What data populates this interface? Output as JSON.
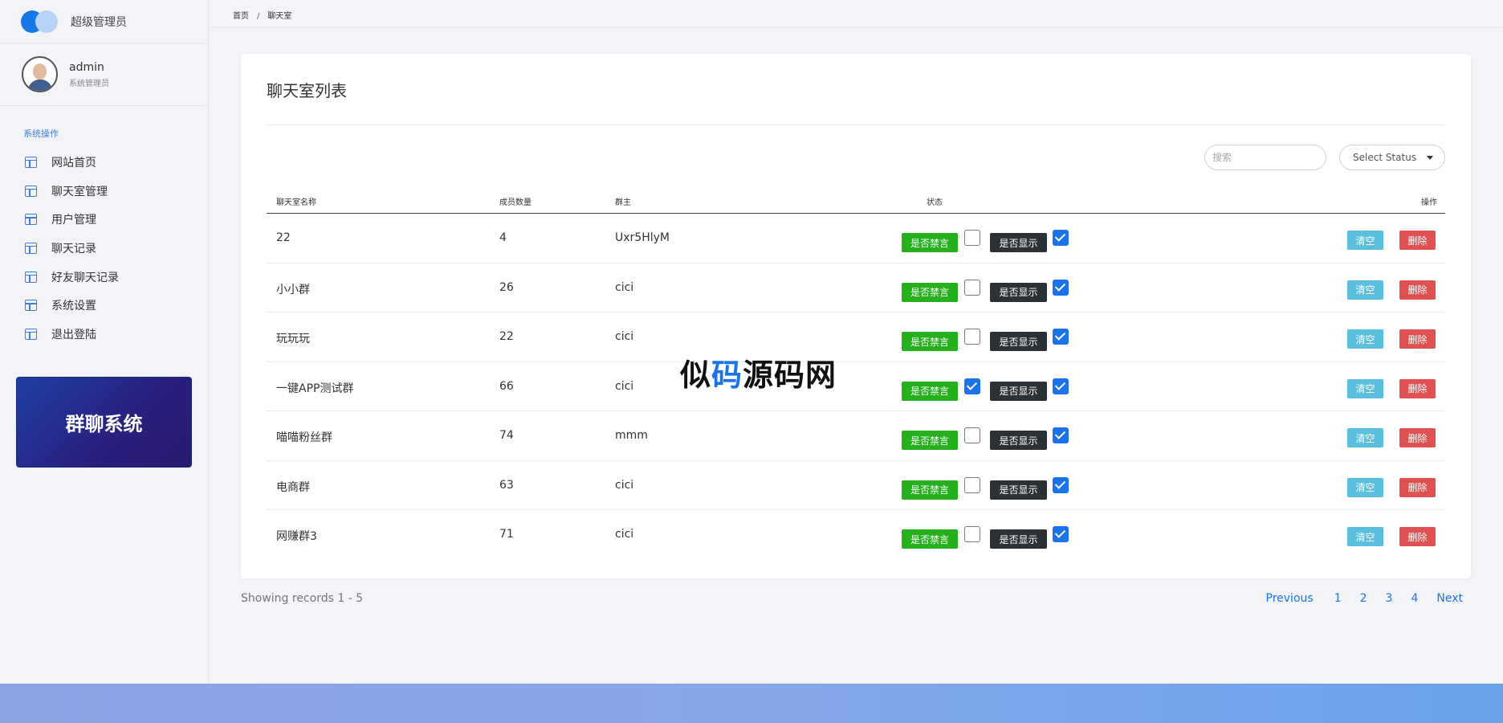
{
  "sidebar": {
    "brand_title": "超级管理员",
    "user": {
      "name": "admin",
      "role": "系统管理员"
    },
    "menu_title": "系统操作",
    "items": [
      {
        "label": "网站首页"
      },
      {
        "label": "聊天室管理"
      },
      {
        "label": "用户管理"
      },
      {
        "label": "聊天记录"
      },
      {
        "label": "好友聊天记录"
      },
      {
        "label": "系统设置"
      },
      {
        "label": "退出登陆"
      }
    ],
    "promo": "群聊系统"
  },
  "breadcrumb": {
    "home": "首页",
    "sep": "/",
    "current": "聊天室"
  },
  "card": {
    "title": "聊天室列表",
    "search_placeholder": "搜索",
    "status_select": "Select Status"
  },
  "table": {
    "headers": {
      "name": "聊天室名称",
      "count": "成员数量",
      "owner": "群主",
      "status": "状态",
      "action": "操作"
    },
    "mute_label": "是否禁言",
    "show_label": "是否显示",
    "clear_label": "清空",
    "delete_label": "删除",
    "rows": [
      {
        "name": "22",
        "count": "4",
        "owner": "Uxr5HlyM",
        "muted": false,
        "shown": true
      },
      {
        "name": "小小群",
        "count": "26",
        "owner": "cici",
        "muted": false,
        "shown": true
      },
      {
        "name": "玩玩玩",
        "count": "22",
        "owner": "cici",
        "muted": false,
        "shown": true
      },
      {
        "name": "一键APP测试群",
        "count": "66",
        "owner": "cici",
        "muted": true,
        "shown": true
      },
      {
        "name": "喵喵粉丝群",
        "count": "74",
        "owner": "mmm",
        "muted": false,
        "shown": true
      },
      {
        "name": "电商群",
        "count": "63",
        "owner": "cici",
        "muted": false,
        "shown": true
      },
      {
        "name": "网赚群3",
        "count": "71",
        "owner": "cici",
        "muted": false,
        "shown": true
      }
    ]
  },
  "watermark": {
    "part1": "似",
    "part2": "码",
    "part3": "源码网"
  },
  "pagination": {
    "records": "Showing records 1 - 5",
    "prev": "Previous",
    "pages": [
      "1",
      "2",
      "3",
      "4"
    ],
    "next": "Next"
  },
  "colors": {
    "accent": "#1a73e8",
    "mute_btn": "#26b01d",
    "show_btn": "#2c3136",
    "clear_btn": "#5bc0de",
    "delete_btn": "#e05252"
  }
}
